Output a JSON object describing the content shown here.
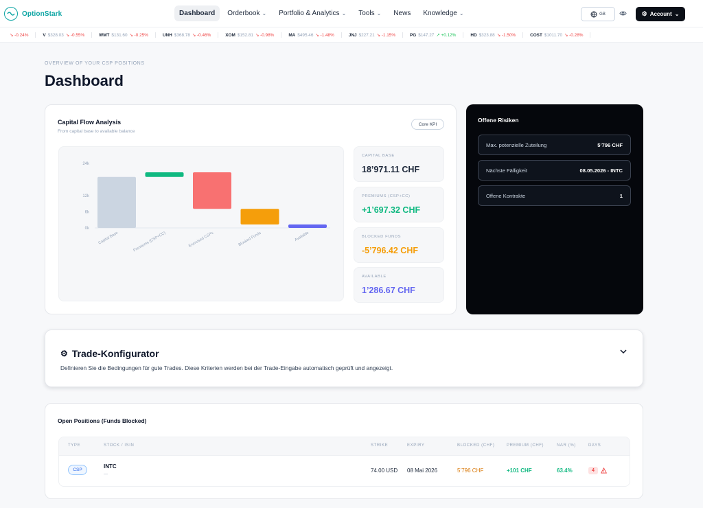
{
  "app": {
    "name": "OptionStark"
  },
  "nav": {
    "items": [
      {
        "label": "Dashboard",
        "caret": false
      },
      {
        "label": "Orderbook",
        "caret": true
      },
      {
        "label": "Portfolio & Analytics",
        "caret": true
      },
      {
        "label": "Tools",
        "caret": true
      },
      {
        "label": "News",
        "caret": false
      },
      {
        "label": "Knowledge",
        "caret": true
      }
    ],
    "lang": "GB",
    "account": "Account"
  },
  "ticker": [
    {
      "sym": "",
      "price": "",
      "chg": "-0.24%",
      "dir": "down"
    },
    {
      "sym": "V",
      "price": "$328.03",
      "chg": "-0.55%",
      "dir": "down"
    },
    {
      "sym": "WMT",
      "price": "$131.60",
      "chg": "-0.25%",
      "dir": "down"
    },
    {
      "sym": "UNH",
      "price": "$368.78",
      "chg": "-0.46%",
      "dir": "down"
    },
    {
      "sym": "XOM",
      "price": "$152.81",
      "chg": "-0.98%",
      "dir": "down"
    },
    {
      "sym": "MA",
      "price": "$495.46",
      "chg": "-1.48%",
      "dir": "down"
    },
    {
      "sym": "JNJ",
      "price": "$227.21",
      "chg": "-1.15%",
      "dir": "down"
    },
    {
      "sym": "PG",
      "price": "$147.27",
      "chg": "+0.12%",
      "dir": "up"
    },
    {
      "sym": "HD",
      "price": "$323.88",
      "chg": "-1.50%",
      "dir": "down"
    },
    {
      "sym": "COST",
      "price": "$1011.70",
      "chg": "-0.28%",
      "dir": "down"
    }
  ],
  "header": {
    "eyebrow": "OVERVIEW OF YOUR CSP POSITIONS",
    "title": "Dashboard"
  },
  "capital_flow": {
    "title": "Capital Flow Analysis",
    "subtitle": "From capital base to available balance",
    "badge": "Core KPI",
    "kpis": [
      {
        "label": "CAPITAL BASE",
        "value": "18’971.11 CHF",
        "color": "#1e293b"
      },
      {
        "label": "PREMIUMS (CSP+CC)",
        "value": "+1’697.32 CHF",
        "color": "#10b981"
      },
      {
        "label": "BLOCKED FUNDS",
        "value": "-5’796.42 CHF",
        "color": "#f59e0b"
      },
      {
        "label": "AVAILABLE",
        "value": "1’286.67 CHF",
        "color": "#6366f1"
      }
    ]
  },
  "chart_data": {
    "type": "bar",
    "subtype": "waterfall",
    "categories": [
      "Capital Base",
      "Premiums (CSP+CC)",
      "Exercised CSPs",
      "Blocked Funds",
      "Available"
    ],
    "bars": [
      {
        "start": 0,
        "end": 18971.11,
        "color": "#cbd5e1"
      },
      {
        "start": 18971.11,
        "end": 20668.43,
        "color": "#10b981"
      },
      {
        "start": 20668.43,
        "end": 7083.09,
        "color": "#f87171"
      },
      {
        "start": 7083.09,
        "end": 1286.67,
        "color": "#f59e0b"
      },
      {
        "start": 0,
        "end": 1286.67,
        "color": "#6366f1"
      }
    ],
    "yticks": [
      {
        "value": 0,
        "label": "0k"
      },
      {
        "value": 6000,
        "label": "6k"
      },
      {
        "value": 12000,
        "label": "12k"
      },
      {
        "value": 24000,
        "label": "24k"
      }
    ],
    "ylim": [
      0,
      24000
    ],
    "grid": false,
    "legend": "none"
  },
  "risks": {
    "title": "Offene Risiken",
    "rows": [
      {
        "label": "Max. potenzielle Zuteilung",
        "value": "5’796 CHF"
      },
      {
        "label": "Nächste Fälligkeit",
        "value": "08.05.2026 - INTC"
      },
      {
        "label": "Offene Kontrakte",
        "value": "1"
      }
    ]
  },
  "trade_config": {
    "title": "Trade-Konfigurator",
    "description": "Definieren Sie die Bedingungen für gute Trades. Diese Kriterien werden bei der Trade-Eingabe automatisch geprüft und angezeigt."
  },
  "positions": {
    "title": "Open Positions (Funds Blocked)",
    "columns": [
      "TYPE",
      "STOCK / ISIN",
      "STRIKE",
      "EXPIRY",
      "BLOCKED (CHF)",
      "PREMIUM (CHF)",
      "NAR (%)",
      "DAYS"
    ],
    "rows": [
      {
        "type": "CSP",
        "stock": "INTC",
        "isin": "—",
        "strike": "74.00 USD",
        "expiry": "08 Mai 2026",
        "blocked": "5’796 CHF",
        "premium": "+101 CHF",
        "nar": "63.4%",
        "days": "4"
      }
    ]
  },
  "colors": {
    "accent": "#0ea5a4",
    "dark": "#05070c"
  }
}
